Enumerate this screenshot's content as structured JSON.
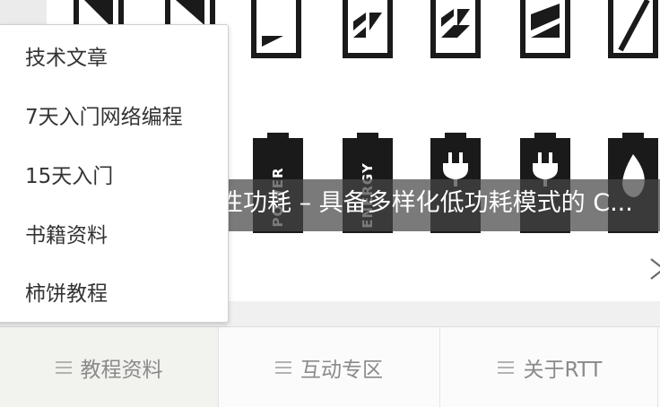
{
  "banner": {
    "caption": "性功耗 – 具备多样化低功耗模式的 C...",
    "battery_labels": [
      "POWER",
      "ENERGY"
    ]
  },
  "dropdown": {
    "items": [
      {
        "label": "技术文章"
      },
      {
        "label": "7天入门网络编程"
      },
      {
        "label": "15天入门"
      },
      {
        "label": "书籍资料"
      },
      {
        "label": "柿饼教程"
      }
    ]
  },
  "tabs": [
    {
      "label": "教程资料",
      "icon": "menu-icon",
      "active": true
    },
    {
      "label": "互动专区",
      "icon": "menu-icon",
      "active": false
    },
    {
      "label": "关于RTT",
      "icon": "menu-icon",
      "active": false
    }
  ],
  "colors": {
    "dropdown_text": "#333333",
    "tab_text": "#8a8a8a",
    "caption_bg": "#464646",
    "battery": "#1a1a1a"
  }
}
